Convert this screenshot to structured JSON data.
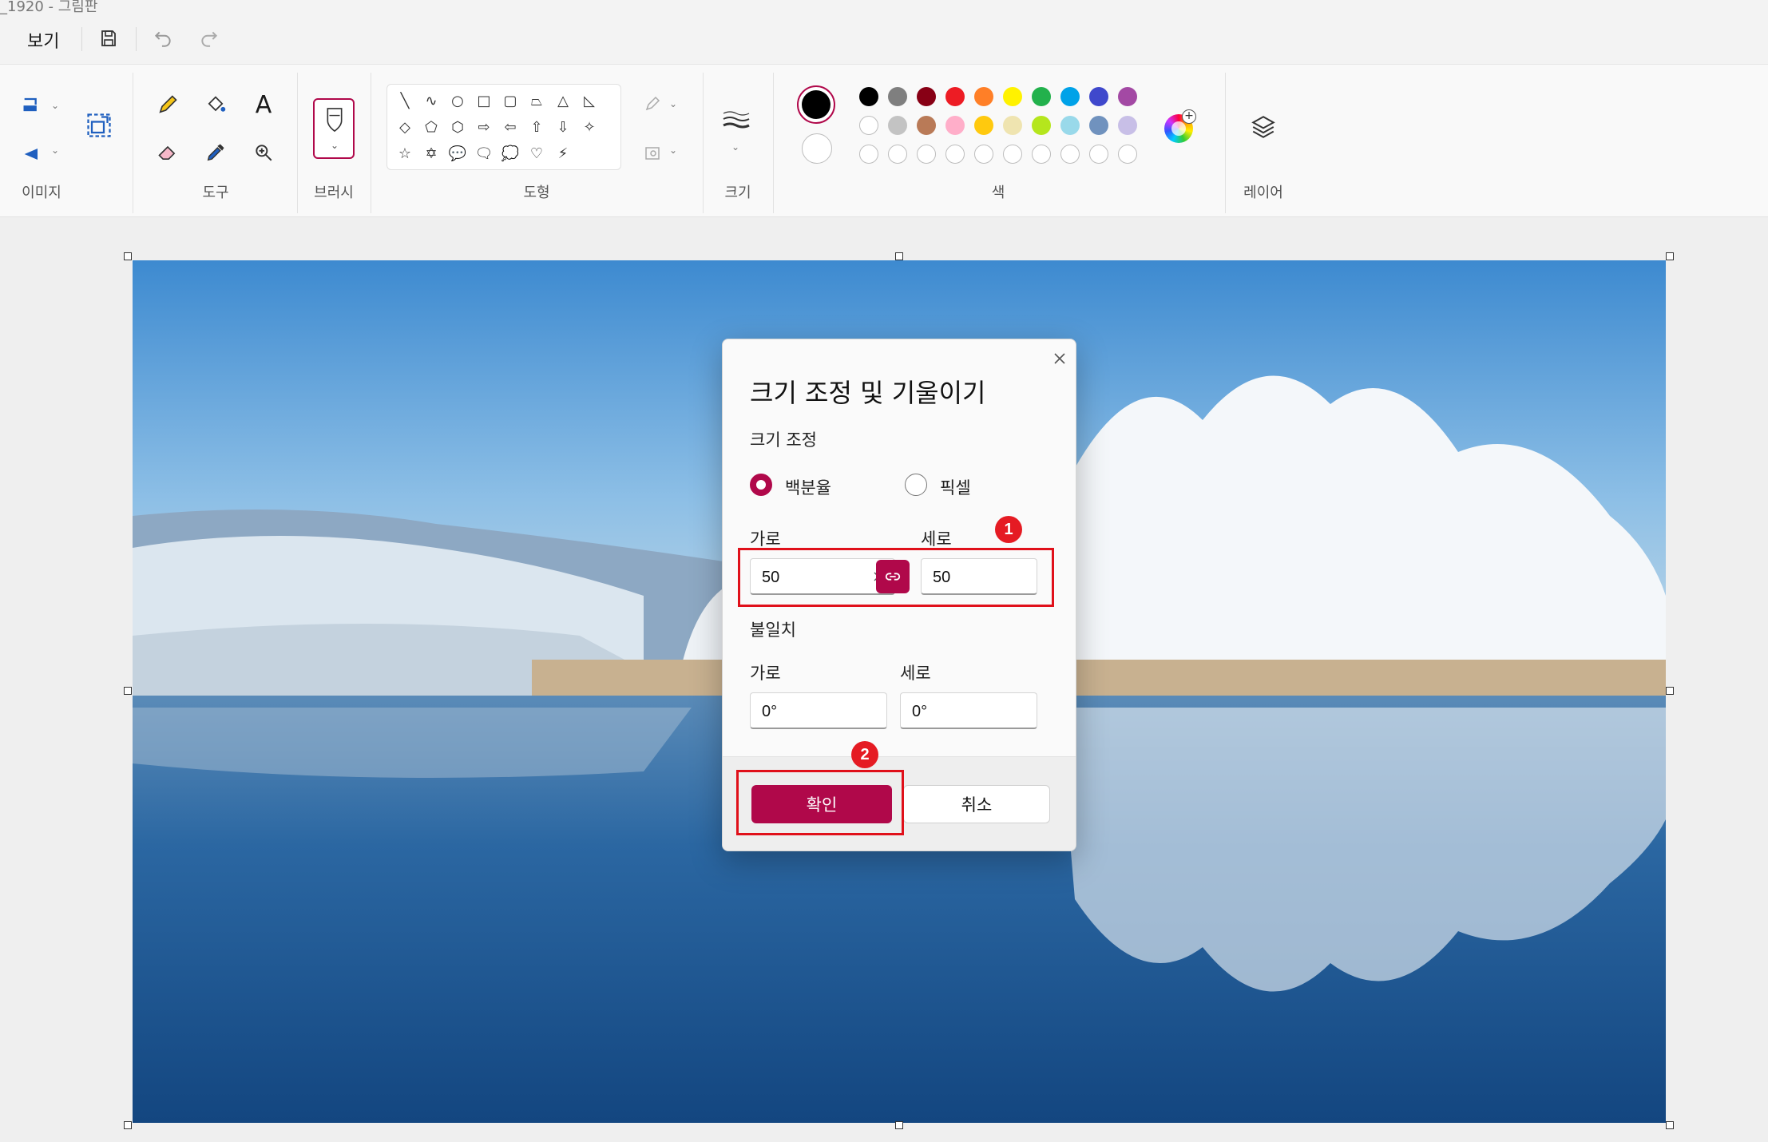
{
  "window": {
    "title": "_1920 - 그림판"
  },
  "menu": {
    "view_label": "보기"
  },
  "ribbon": {
    "groups": {
      "image": "이미지",
      "tools": "도구",
      "brushes": "브러시",
      "shapes": "도형",
      "size": "크기",
      "colors": "색",
      "layers": "레이어"
    },
    "shapes_row1": [
      "╲",
      "∿",
      "○",
      "□",
      "▢",
      "⏢",
      "△",
      "◺"
    ],
    "shapes_row2": [
      "◇",
      "⬠",
      "⬡",
      "⇨",
      "⇦",
      "⇧",
      "⇩",
      "✧"
    ],
    "shapes_row3": [
      "☆",
      "✡",
      "💬",
      "🗨",
      "💭",
      "♡",
      "⚡"
    ],
    "palette_row1": [
      "#000000",
      "#7f7f7f",
      "#880015",
      "#ed1c24",
      "#ff7f27",
      "#fff200",
      "#22b14c",
      "#00a2e8",
      "#3f48cc",
      "#a349a4"
    ],
    "palette_row2": [
      "#ffffff",
      "#c3c3c3",
      "#b97a57",
      "#ffaec9",
      "#ffc90e",
      "#efe4b0",
      "#b5e61d",
      "#99d9ea",
      "#7092be",
      "#c8bfe7"
    ],
    "palette_row3_count": 10,
    "accent_color": "#b0084a"
  },
  "dialog": {
    "title": "크기 조정 및 기울이기",
    "resize_section": "크기 조정",
    "option_percent": "백분율",
    "option_pixel": "픽셀",
    "selected_option": "백분율",
    "width_label": "가로",
    "height_label": "세로",
    "width_value": "50",
    "height_value": "50",
    "aspect_locked": true,
    "skew_section": "불일치",
    "skew_h_label": "가로",
    "skew_v_label": "세로",
    "skew_h_value": "0°",
    "skew_v_value": "0°",
    "ok_label": "확인",
    "cancel_label": "취소"
  },
  "annotations": {
    "badge1": "1",
    "badge2": "2",
    "color": "#e0101a"
  }
}
